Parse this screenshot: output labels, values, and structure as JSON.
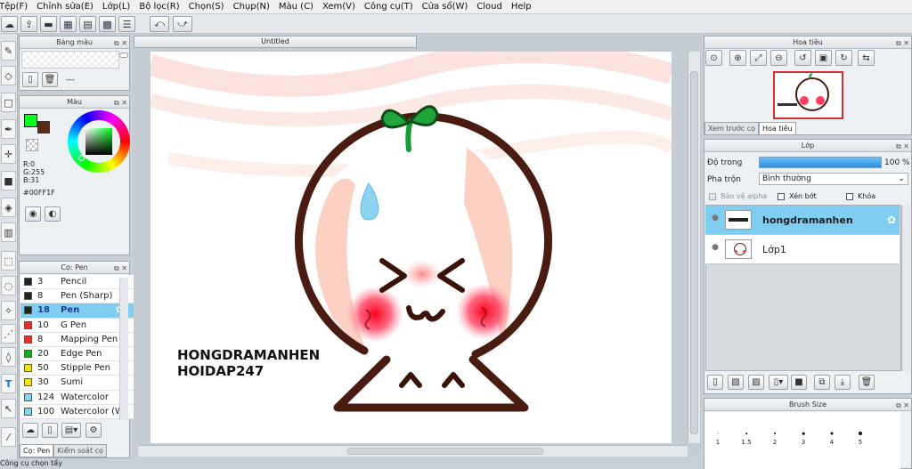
{
  "menu": [
    "Tệp(F)",
    "Chỉnh sửa(E)",
    "Lớp(L)",
    "Bộ lọc(R)",
    "Chọn(S)",
    "Chụp(N)",
    "Màu (C)",
    "Xem(V)",
    "Công cụ(T)",
    "Cửa sổ(W)",
    "Cloud",
    "Help"
  ],
  "toolbar_icons": [
    "cloud-icon",
    "export-icon",
    "chat-icon",
    "comic-icon",
    "page-icon",
    "grid-icon",
    "settings-list-icon",
    "undo-icon",
    "redo-icon"
  ],
  "palette_panel": {
    "title": "Bảng màu",
    "value": "---"
  },
  "color_panel": {
    "title": "Màu",
    "r": "R:0",
    "g": "G:255",
    "b": "B:31",
    "hex": "#00FF1F",
    "main_color": "#00ff1f",
    "sub_color": "#5a2a14"
  },
  "brush_panel": {
    "title": "Cọ: Pen",
    "items": [
      {
        "size": "3",
        "name": "Pencil",
        "color": "#222222"
      },
      {
        "size": "8",
        "name": "Pen (Sharp)",
        "color": "#222222"
      },
      {
        "size": "18",
        "name": "Pen",
        "color": "#222222",
        "selected": true
      },
      {
        "size": "10",
        "name": "G Pen",
        "color": "#e03030"
      },
      {
        "size": "8",
        "name": "Mapping Pen",
        "color": "#e03030"
      },
      {
        "size": "20",
        "name": "Edge Pen",
        "color": "#1fa51f"
      },
      {
        "size": "50",
        "name": "Stipple Pen",
        "color": "#f0e020"
      },
      {
        "size": "30",
        "name": "Sumi",
        "color": "#f0e020"
      },
      {
        "size": "124",
        "name": "Watercolor",
        "color": "#7fd8f0"
      },
      {
        "size": "100",
        "name": "Watercolor (W",
        "color": "#7fd8f0"
      }
    ],
    "tabs": [
      "Cọ: Pen",
      "Kiểm soát cọ"
    ]
  },
  "document": {
    "tab_title": "Untitled",
    "watermark_line1": "HONGDRAMANHEN",
    "watermark_line2": "HOIDAP247"
  },
  "navigator": {
    "title": "Hoa tiêu",
    "tabs": [
      "Xem trước cọ",
      "Hoa tiêu"
    ]
  },
  "layer_panel": {
    "title": "Lớp",
    "opacity_label": "Độ trong",
    "opacity_value": "100 %",
    "opacity_fraction": 1.0,
    "blend_label": "Pha trộn",
    "blend_value": "Bình thường",
    "protect_alpha": "Bảo vệ alpha",
    "clipping": "Xén bớt",
    "lock": "Khóa",
    "layers": [
      {
        "name": "hongdramanhen",
        "selected": true
      },
      {
        "name": "Lớp1",
        "selected": false
      }
    ]
  },
  "brush_size_panel": {
    "title": "Brush Size",
    "sizes": [
      "1",
      "1.5",
      "2",
      "3",
      "4",
      "5"
    ]
  },
  "status": "Công cụ chọn tẩy"
}
